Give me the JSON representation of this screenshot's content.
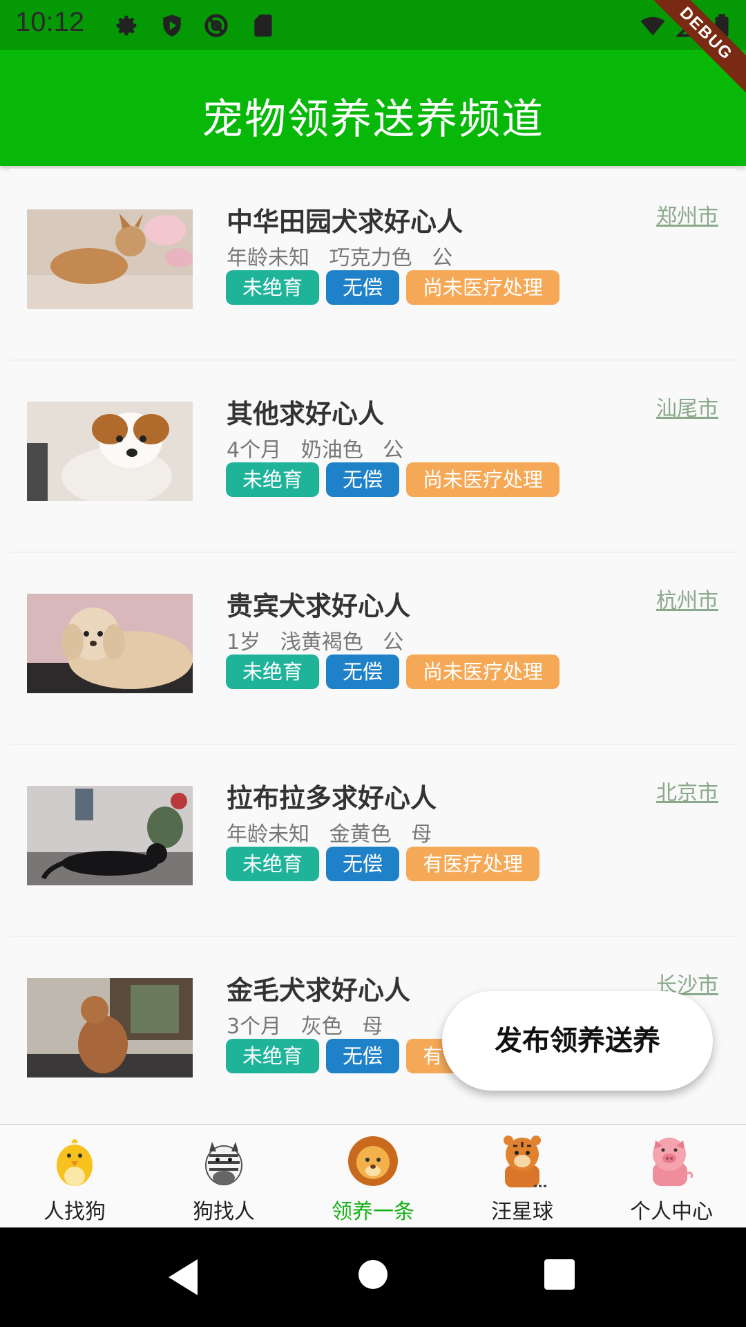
{
  "status_bar": {
    "time": "10:12"
  },
  "debug_banner": "DEBUG",
  "app_bar": {
    "title": "宠物领养送养频道"
  },
  "colors": {
    "primary_green": "#08b808",
    "tag_green": "#1fb39a",
    "tag_blue": "#1f82c8",
    "tag_orange": "#f5a957"
  },
  "listings": [
    {
      "title": "中华田园犬求好心人",
      "subtitle": "年龄未知   巧克力色   公",
      "tags": [
        "未绝育",
        "无偿",
        "尚未医疗处理"
      ],
      "city": "郑州市"
    },
    {
      "title": "其他求好心人",
      "subtitle": "4个月   奶油色   公",
      "tags": [
        "未绝育",
        "无偿",
        "尚未医疗处理"
      ],
      "city": "汕尾市"
    },
    {
      "title": "贵宾犬求好心人",
      "subtitle": "1岁   浅黄褐色   公",
      "tags": [
        "未绝育",
        "无偿",
        "尚未医疗处理"
      ],
      "city": "杭州市"
    },
    {
      "title": "拉布拉多求好心人",
      "subtitle": "年龄未知   金黄色   母",
      "tags": [
        "未绝育",
        "无偿",
        "有医疗处理"
      ],
      "city": "北京市"
    },
    {
      "title": "金毛犬求好心人",
      "subtitle": "3个月   灰色   母",
      "tags": [
        "未绝育",
        "无偿",
        "有"
      ],
      "city": "长沙市"
    }
  ],
  "fab": {
    "label": "发布领养送养"
  },
  "bottom_nav": [
    {
      "label": "人找狗",
      "icon": "chick-icon",
      "active": false
    },
    {
      "label": "狗找人",
      "icon": "zebra-icon",
      "active": false
    },
    {
      "label": "领养一条",
      "icon": "lion-icon",
      "active": true
    },
    {
      "label": "汪星球",
      "icon": "tiger-icon",
      "active": false
    },
    {
      "label": "个人中心",
      "icon": "pig-icon",
      "active": false
    }
  ]
}
